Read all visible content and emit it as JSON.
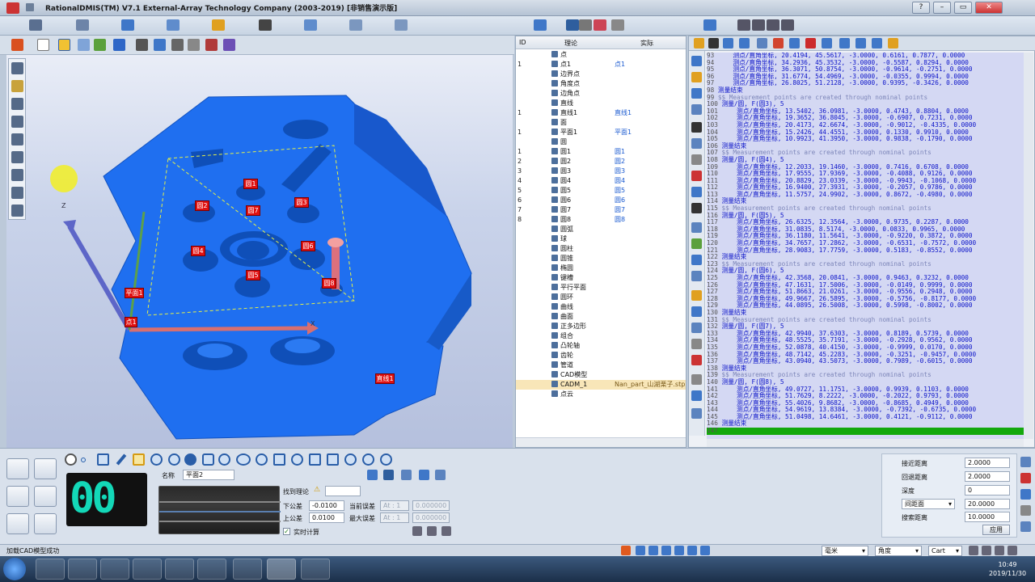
{
  "window": {
    "title": "RationalDMIS(TM) V7.1    External-Array Technology Company (2003-2019) [非销售演示版]"
  },
  "tree": {
    "headers": {
      "id": "ID",
      "theory": "理论",
      "actual": "实际"
    },
    "rows": [
      {
        "id": "",
        "theory": "点",
        "actual": ""
      },
      {
        "id": "1",
        "theory": "点1",
        "actual": "点1"
      },
      {
        "id": "",
        "theory": "边界点",
        "actual": ""
      },
      {
        "id": "",
        "theory": "角度点",
        "actual": ""
      },
      {
        "id": "",
        "theory": "边角点",
        "actual": ""
      },
      {
        "id": "",
        "theory": "直线",
        "actual": ""
      },
      {
        "id": "1",
        "theory": "直线1",
        "actual": "直线1"
      },
      {
        "id": "",
        "theory": "面",
        "actual": ""
      },
      {
        "id": "1",
        "theory": "平面1",
        "actual": "平面1"
      },
      {
        "id": "",
        "theory": "圆",
        "actual": ""
      },
      {
        "id": "1",
        "theory": "圆1",
        "actual": "圆1"
      },
      {
        "id": "2",
        "theory": "圆2",
        "actual": "圆2"
      },
      {
        "id": "3",
        "theory": "圆3",
        "actual": "圆3"
      },
      {
        "id": "4",
        "theory": "圆4",
        "actual": "圆4"
      },
      {
        "id": "5",
        "theory": "圆5",
        "actual": "圆5"
      },
      {
        "id": "6",
        "theory": "圆6",
        "actual": "圆6"
      },
      {
        "id": "7",
        "theory": "圆7",
        "actual": "圆7"
      },
      {
        "id": "8",
        "theory": "圆8",
        "actual": "圆8"
      },
      {
        "id": "",
        "theory": "圆弧",
        "actual": ""
      },
      {
        "id": "",
        "theory": "球",
        "actual": ""
      },
      {
        "id": "",
        "theory": "圆柱",
        "actual": ""
      },
      {
        "id": "",
        "theory": "圆锥",
        "actual": ""
      },
      {
        "id": "",
        "theory": "椭圆",
        "actual": ""
      },
      {
        "id": "",
        "theory": "键槽",
        "actual": ""
      },
      {
        "id": "",
        "theory": "平行平面",
        "actual": ""
      },
      {
        "id": "",
        "theory": "圆环",
        "actual": ""
      },
      {
        "id": "",
        "theory": "曲线",
        "actual": ""
      },
      {
        "id": "",
        "theory": "曲面",
        "actual": ""
      },
      {
        "id": "",
        "theory": "正多边形",
        "actual": ""
      },
      {
        "id": "",
        "theory": "组合",
        "actual": ""
      },
      {
        "id": "",
        "theory": "凸轮轴",
        "actual": ""
      },
      {
        "id": "",
        "theory": "齿轮",
        "actual": ""
      },
      {
        "id": "",
        "theory": "管道",
        "actual": ""
      },
      {
        "id": "",
        "theory": "CAD模型",
        "actual": ""
      },
      {
        "id": "",
        "theory": "CADM_1",
        "actual": "Nan_part_山湖栗子.stp"
      },
      {
        "id": "",
        "theory": "点云",
        "actual": ""
      }
    ]
  },
  "viewport": {
    "labels": [
      "圆1",
      "圆2",
      "圆3",
      "圆4",
      "圆5",
      "圆6",
      "圆7",
      "圆8",
      "平面1",
      "点1",
      "直线1"
    ],
    "axis_x": "X",
    "axis_z": "Z"
  },
  "code": {
    "lines": [
      {
        "n": "93",
        "t": "    测点/直角坐标, 20.4194, 45.5617, -3.0000, 0.6161, 0.7877, 0.0000",
        "k": "kw"
      },
      {
        "n": "94",
        "t": "    测点/直角坐标, 34.2936, 45.3532, -3.0000, -0.5587, 0.8294, 0.0000",
        "k": "kw"
      },
      {
        "n": "95",
        "t": "    测点/直角坐标, 36.3071, 50.8754, -3.0000, -0.9614, -0.2751, 0.0000",
        "k": "kw"
      },
      {
        "n": "96",
        "t": "    测点/直角坐标, 31.6774, 54.4969, -3.0000, -0.0355, 0.9994, 0.0000",
        "k": "kw"
      },
      {
        "n": "97",
        "t": "    测点/直角坐标, 26.8025, 51.2128, -3.0000, 0.9395, -0.3426, 0.0000",
        "k": "kw"
      },
      {
        "n": "98",
        "t": "测量结束",
        "k": "kw"
      },
      {
        "n": "99",
        "t": "$$ Measurement points are created through nominal points",
        "k": "cm"
      },
      {
        "n": "100",
        "t": "测量/圆, F(圆3), 5",
        "k": "kw"
      },
      {
        "n": "101",
        "t": "    测点/直角坐标, 13.5402, 36.0981, -3.0000, 0.4743, 0.8804, 0.0000",
        "k": "kw"
      },
      {
        "n": "102",
        "t": "    测点/直角坐标, 19.3652, 36.8045, -3.0000, -0.6907, 0.7231, 0.0000",
        "k": "kw"
      },
      {
        "n": "103",
        "t": "    测点/直角坐标, 20.4173, 42.6674, -3.0000, -0.9012, -0.4335, 0.0000",
        "k": "kw"
      },
      {
        "n": "104",
        "t": "    测点/直角坐标, 15.2426, 44.4551, -3.0000, 0.1330, 0.9910, 0.0000",
        "k": "kw"
      },
      {
        "n": "105",
        "t": "    测点/直角坐标, 10.9923, 41.3950, -3.0000, 0.9838, -0.1790, 0.0000",
        "k": "kw"
      },
      {
        "n": "106",
        "t": "测量结束",
        "k": "kw"
      },
      {
        "n": "107",
        "t": "$$ Measurement points are created through nominal points",
        "k": "cm"
      },
      {
        "n": "108",
        "t": "测量/圆, F(圆4), 5",
        "k": "kw"
      },
      {
        "n": "109",
        "t": "    测点/直角坐标, 12.2033, 19.1460, -3.0000, 0.7416, 0.6708, 0.0000",
        "k": "kw"
      },
      {
        "n": "110",
        "t": "    测点/直角坐标, 17.9555, 17.9369, -3.0000, -0.4088, 0.9126, 0.0000",
        "k": "kw"
      },
      {
        "n": "111",
        "t": "    测点/直角坐标, 20.8829, 23.0339, -3.0000, -0.9943, -0.1068, 0.0000",
        "k": "kw"
      },
      {
        "n": "112",
        "t": "    测点/直角坐标, 16.9400, 27.3931, -3.0000, -0.2057, 0.9786, 0.0000",
        "k": "kw"
      },
      {
        "n": "113",
        "t": "    测点/直角坐标, 11.5757, 24.9902, -3.0000, 0.8672, -0.4980, 0.0000",
        "k": "kw"
      },
      {
        "n": "114",
        "t": "测量结束",
        "k": "kw"
      },
      {
        "n": "115",
        "t": "$$ Measurement points are created through nominal points",
        "k": "cm"
      },
      {
        "n": "116",
        "t": "测量/圆, F(圆5), 5",
        "k": "kw"
      },
      {
        "n": "117",
        "t": "    测点/直角坐标, 26.6325, 12.3564, -3.0000, 0.9735, 0.2287, 0.0000",
        "k": "kw"
      },
      {
        "n": "118",
        "t": "    测点/直角坐标, 31.0835, 8.5174, -3.0000, 0.0833, 0.9965, 0.0000",
        "k": "kw"
      },
      {
        "n": "119",
        "t": "    测点/直角坐标, 36.1180, 11.5641, -3.0000, -0.9220, 0.3872, 0.0000",
        "k": "kw"
      },
      {
        "n": "120",
        "t": "    测点/直角坐标, 34.7657, 17.2862, -3.0000, -0.6531, -0.7572, 0.0000",
        "k": "kw"
      },
      {
        "n": "121",
        "t": "    测点/直角坐标, 28.9083, 17.7759, -3.0000, 0.5183, -0.8552, 0.0000",
        "k": "kw"
      },
      {
        "n": "122",
        "t": "测量结束",
        "k": "kw"
      },
      {
        "n": "123",
        "t": "$$ Measurement points are created through nominal points",
        "k": "cm"
      },
      {
        "n": "124",
        "t": "测量/圆, F(圆6), 5",
        "k": "kw"
      },
      {
        "n": "125",
        "t": "    测点/直角坐标, 42.3568, 20.0841, -3.0000, 0.9463, 0.3232, 0.0000",
        "k": "kw"
      },
      {
        "n": "126",
        "t": "    测点/直角坐标, 47.1631, 17.5006, -3.0000, -0.0149, 0.9999, 0.0000",
        "k": "kw"
      },
      {
        "n": "127",
        "t": "    测点/直角坐标, 51.8663, 21.0261, -3.0000, -0.9556, 0.2948, 0.0000",
        "k": "kw"
      },
      {
        "n": "128",
        "t": "    测点/直角坐标, 49.9667, 26.5895, -3.0000, -0.5756, -0.8177, 0.0000",
        "k": "kw"
      },
      {
        "n": "129",
        "t": "    测点/直角坐标, 44.0895, 26.5008, -3.0000, 0.5998, -0.8002, 0.0000",
        "k": "kw"
      },
      {
        "n": "130",
        "t": "测量结束",
        "k": "kw"
      },
      {
        "n": "131",
        "t": "$$ Measurement points are created through nominal points",
        "k": "cm"
      },
      {
        "n": "132",
        "t": "测量/圆, F(圆7), 5",
        "k": "kw"
      },
      {
        "n": "133",
        "t": "    测点/直角坐标, 42.9940, 37.6303, -3.0000, 0.8189, 0.5739, 0.0000",
        "k": "kw"
      },
      {
        "n": "134",
        "t": "    测点/直角坐标, 48.5525, 35.7191, -3.0000, -0.2928, 0.9562, 0.0000",
        "k": "kw"
      },
      {
        "n": "135",
        "t": "    测点/直角坐标, 52.0878, 40.4150, -3.0000, -0.9999, 0.0170, 0.0000",
        "k": "kw"
      },
      {
        "n": "136",
        "t": "    测点/直角坐标, 48.7142, 45.2283, -3.0000, -0.3251, -0.9457, 0.0000",
        "k": "kw"
      },
      {
        "n": "137",
        "t": "    测点/直角坐标, 43.0940, 43.5073, -3.0000, 0.7989, -0.6015, 0.0000",
        "k": "kw"
      },
      {
        "n": "138",
        "t": "测量结束",
        "k": "kw"
      },
      {
        "n": "139",
        "t": "$$ Measurement points are created through nominal points",
        "k": "cm"
      },
      {
        "n": "140",
        "t": "测量/圆, F(圆8), 5",
        "k": "kw"
      },
      {
        "n": "141",
        "t": "    测点/直角坐标, 49.0727, 11.1751, -3.0000, 0.9939, 0.1103, 0.0000",
        "k": "kw"
      },
      {
        "n": "142",
        "t": "    测点/直角坐标, 51.7629, 8.2222, -3.0000, -0.2022, 0.9793, 0.0000",
        "k": "kw"
      },
      {
        "n": "143",
        "t": "    测点/直角坐标, 55.4026, 9.8682, -3.0000, -0.8685, 0.4949, 0.0000",
        "k": "kw"
      },
      {
        "n": "144",
        "t": "    测点/直角坐标, 54.9619, 13.8384, -3.0000, -0.7392, -0.6735, 0.0000",
        "k": "kw"
      },
      {
        "n": "145",
        "t": "    测点/直角坐标, 51.0498, 14.6461, -3.0000, 0.4121, -0.9112, 0.0000",
        "k": "kw"
      },
      {
        "n": "146",
        "t": "测量结束",
        "k": "kw"
      },
      {
        "n": "147",
        "t": "",
        "k": "active"
      }
    ]
  },
  "feature": {
    "name_label": "名称",
    "name_value": "平面2",
    "find_label": "找到理论",
    "find_value": "",
    "lower_tol_label": "下公差",
    "lower_tol": "-0.0100",
    "upper_tol_label": "上公差",
    "upper_tol": "0.0100",
    "cur_err_label": "当前误差",
    "cur_err_a": "At : 1",
    "cur_err_b": "0.000000",
    "max_err_label": "最大误差",
    "max_err_a": "At : 1",
    "max_err_b": "0.000000",
    "realtime_label": "实时计算",
    "counter": "00"
  },
  "probe_params": {
    "approach_label": "接近距离",
    "approach": "2.0000",
    "retract_label": "回退距离",
    "retract": "2.0000",
    "depth_label": "深度",
    "depth": "0",
    "distance_mode": "间距面",
    "distance_value": "20.0000",
    "search_label": "搜索距离",
    "search": "10.0000",
    "apply_label": "应用"
  },
  "status": {
    "message": "加载CAD模型成功",
    "unit": "毫米",
    "angle": "角度",
    "coord": "Cart"
  },
  "taskbar": {
    "time": "10:49",
    "date": "2019/11/30"
  },
  "colors": {
    "model": "#1f6ff0",
    "label_red": "#e01010",
    "active_line": "#14a80d"
  }
}
